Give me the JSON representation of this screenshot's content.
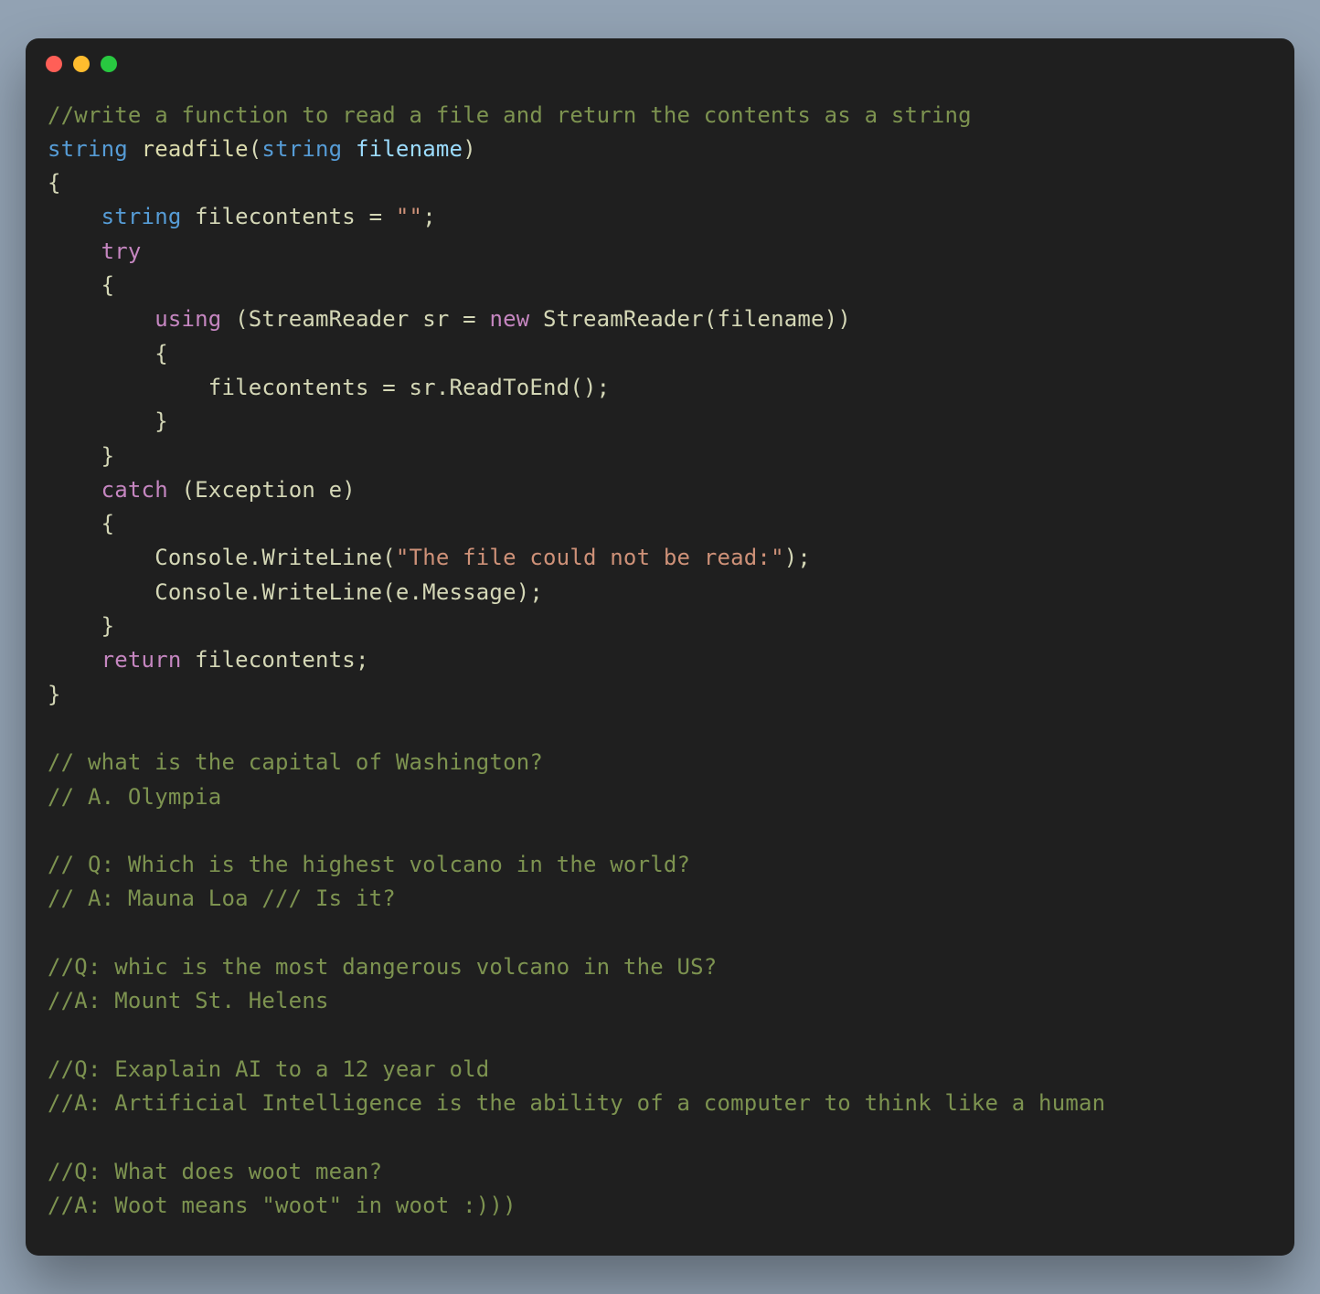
{
  "window": {
    "controls": {
      "red": "close",
      "yellow": "minimize",
      "green": "zoom"
    }
  },
  "code": {
    "line1_comment": "//write a function to read a file and return the contents as a string",
    "line2": {
      "type1": "string",
      "space": " ",
      "func": "readfile",
      "lparen": "(",
      "type2": "string",
      "space2": " ",
      "param": "filename",
      "rparen": ")"
    },
    "line3_brace": "{",
    "line4": {
      "indent": "    ",
      "type": "string",
      "rest": " filecontents = ",
      "str": "\"\"",
      "semi": ";"
    },
    "line5": {
      "indent": "    ",
      "kw": "try"
    },
    "line6": {
      "indent": "    ",
      "brace": "{"
    },
    "line7": {
      "indent": "        ",
      "kw": "using",
      "text1": " (StreamReader sr = ",
      "kw2": "new",
      "text2": " StreamReader(filename))"
    },
    "line8": {
      "indent": "        ",
      "brace": "{"
    },
    "line9": {
      "indent": "            ",
      "text": "filecontents = sr.ReadToEnd();"
    },
    "line10": {
      "indent": "        ",
      "brace": "}"
    },
    "line11": {
      "indent": "    ",
      "brace": "}"
    },
    "line12": {
      "indent": "    ",
      "kw": "catch",
      "text": " (Exception e)"
    },
    "line13": {
      "indent": "    ",
      "brace": "{"
    },
    "line14": {
      "indent": "        ",
      "text1": "Console.WriteLine(",
      "str": "\"The file could not be read:\"",
      "text2": ");"
    },
    "line15": {
      "indent": "        ",
      "text": "Console.WriteLine(e.Message);"
    },
    "line16": {
      "indent": "    ",
      "brace": "}"
    },
    "line17": {
      "indent": "    ",
      "kw": "return",
      "text": " filecontents;"
    },
    "line18_brace": "}",
    "blank": "",
    "c1": "// what is the capital of Washington?",
    "c2": "// A. Olympia",
    "c3": "// Q: Which is the highest volcano in the world?",
    "c4": "// A: Mauna Loa /// Is it?",
    "c5": "//Q: whic is the most dangerous volcano in the US?",
    "c6": "//A: Mount St. Helens",
    "c7": "//Q: Exaplain AI to a 12 year old",
    "c8": "//A: Artificial Intelligence is the ability of a computer to think like a human",
    "c9": "//Q: What does woot mean?",
    "c10": "//A: Woot means \"woot\" in woot :)))"
  }
}
